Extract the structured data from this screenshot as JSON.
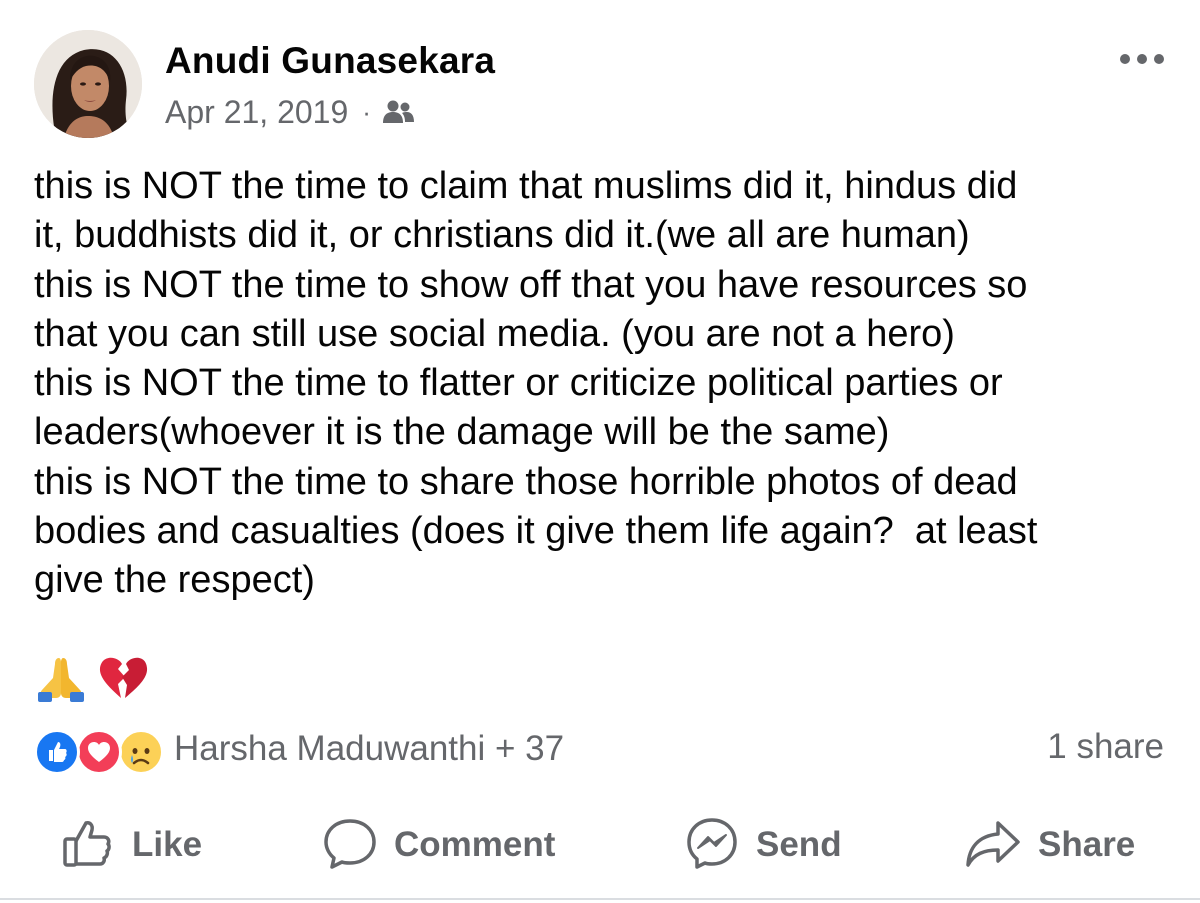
{
  "post": {
    "author": "Anudi Gunasekara",
    "date": "Apr 21, 2019",
    "separator": "·",
    "audience_icon": "friends-icon",
    "lines": [
      "this is NOT the time to claim that muslims did it, hindus did",
      "it, buddhists did it, or christians did it.(we all are human)",
      "this is NOT the time to show off that you have resources so",
      "that you can still use social media. (you are not a hero)",
      "this is NOT the time to flatter or criticize political parties or",
      "leaders(whoever it is the damage will be the same)",
      "this is NOT the time to share those horrible photos of dead",
      "bodies and casualties (does it give them life again?  at least",
      "give the respect)"
    ],
    "emojis": [
      "praying-hands-emoji",
      "broken-heart-emoji"
    ]
  },
  "reactions": {
    "icons": [
      "like-reaction-icon",
      "love-reaction-icon",
      "sad-reaction-icon"
    ],
    "reactors": "Harsha Maduwanthi + 37",
    "shares": "1 share"
  },
  "actions": {
    "like": "Like",
    "comment": "Comment",
    "send": "Send",
    "share": "Share"
  },
  "colors": {
    "text_primary": "#050505",
    "text_secondary": "#65676b",
    "like_blue": "#1877f2",
    "love_red": "#f33e58",
    "sad_yellow": "#fcd157"
  }
}
